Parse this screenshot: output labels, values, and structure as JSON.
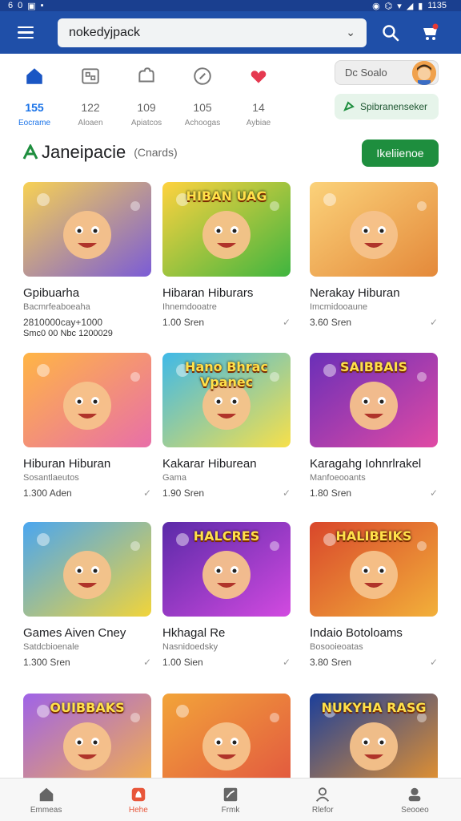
{
  "status_bar": {
    "left_icons": [
      "6",
      "0"
    ],
    "time": "1135"
  },
  "search": {
    "value": "nokedyjpack"
  },
  "categories": [
    {
      "count": "155",
      "label": "Eocrame",
      "icon": "home-icon"
    },
    {
      "count": "122",
      "label": "Aloaen",
      "icon": "apps-icon"
    },
    {
      "count": "109",
      "label": "Apiatcos",
      "icon": "puzzle-icon"
    },
    {
      "count": "105",
      "label": "Achoogas",
      "icon": "compass-icon"
    },
    {
      "count": "14",
      "label": "Aybiae",
      "icon": "heart-icon"
    }
  ],
  "pill_gray": {
    "label": "Dc Soalo"
  },
  "pill_green": {
    "label": "Spibranenseker"
  },
  "section": {
    "title": "Janeipacie",
    "subtitle": "(Cnards)",
    "button": "Ikeliienoe"
  },
  "cards": [
    {
      "name": "Gpibuarha",
      "category": "Bacmrfeaboeaha",
      "price": "2810000cay+1000",
      "extra": "Smc0 00 Nbc 1200029",
      "colors": [
        "#f7d154",
        "#7b5cd6"
      ],
      "check": false
    },
    {
      "name": "Hibaran Hiburars",
      "category": "Ihnemdooatre",
      "price": "1.00 Sren",
      "colors": [
        "#ffd23f",
        "#3fb53f"
      ],
      "check": true
    },
    {
      "name": "Nerakay Hiburan",
      "category": "Imcmidooaune",
      "price": "3.60 Sren",
      "colors": [
        "#fbd27a",
        "#e4893a"
      ],
      "check": true
    },
    {
      "name": "Hiburan Hiburan",
      "category": "Sosantlaeutos",
      "price": "1.300 Aden",
      "colors": [
        "#ffb545",
        "#e86fa8"
      ],
      "check": true
    },
    {
      "name": "Kakarar Hiburean",
      "category": "Gama",
      "price": "1.90 Sren",
      "colors": [
        "#3fb9e8",
        "#f7e04a"
      ],
      "check": true
    },
    {
      "name": "Karagahg Iohnrlrakel",
      "category": "Manfoeooants",
      "price": "1.80 Sren",
      "colors": [
        "#6a2fb8",
        "#e04aa4"
      ],
      "check": true
    },
    {
      "name": "Games Aiven Cney",
      "category": "Satdcbioenale",
      "price": "1.300 Sren",
      "colors": [
        "#4aa6f0",
        "#f1d43a"
      ],
      "check": true
    },
    {
      "name": "Hkhagal Re",
      "category": "Nasnidoedsky",
      "price": "1.00 Sien",
      "colors": [
        "#5a2aa8",
        "#d24ae0"
      ],
      "check": true
    },
    {
      "name": "Indaio Botoloams",
      "category": "Bosooieoatas",
      "price": "3.80 Sren",
      "colors": [
        "#d9472b",
        "#f2b03a"
      ],
      "check": true
    },
    {
      "name": "",
      "category": "",
      "price": "",
      "colors": [
        "#9f63e8",
        "#f5b04a"
      ],
      "check": false
    },
    {
      "name": "",
      "category": "",
      "price": "",
      "colors": [
        "#f2a43a",
        "#e2573f"
      ],
      "check": false
    },
    {
      "name": "",
      "category": "",
      "price": "",
      "colors": [
        "#1c3f9a",
        "#e7932e"
      ],
      "check": false
    }
  ],
  "card_titles": [
    "",
    "HIBAN UAG",
    "",
    "",
    "Hano Bhrac Vpanec",
    "SAIBBAIS",
    "",
    "HALCRES",
    "HALIBEIKS",
    "OUIBBAKS",
    "",
    "NUKYHA RASG"
  ],
  "bottom_nav": [
    {
      "label": "Emmeas",
      "icon": "home-icon"
    },
    {
      "label": "Hehe",
      "icon": "flame-icon"
    },
    {
      "label": "Frmk",
      "icon": "chart-icon"
    },
    {
      "label": "Rlefor",
      "icon": "person-icon"
    },
    {
      "label": "Seooeo",
      "icon": "account-icon"
    }
  ],
  "accent": "#1a73e8",
  "brand_color": "#1f4fa8",
  "primary_button_color": "#1e8e3e"
}
